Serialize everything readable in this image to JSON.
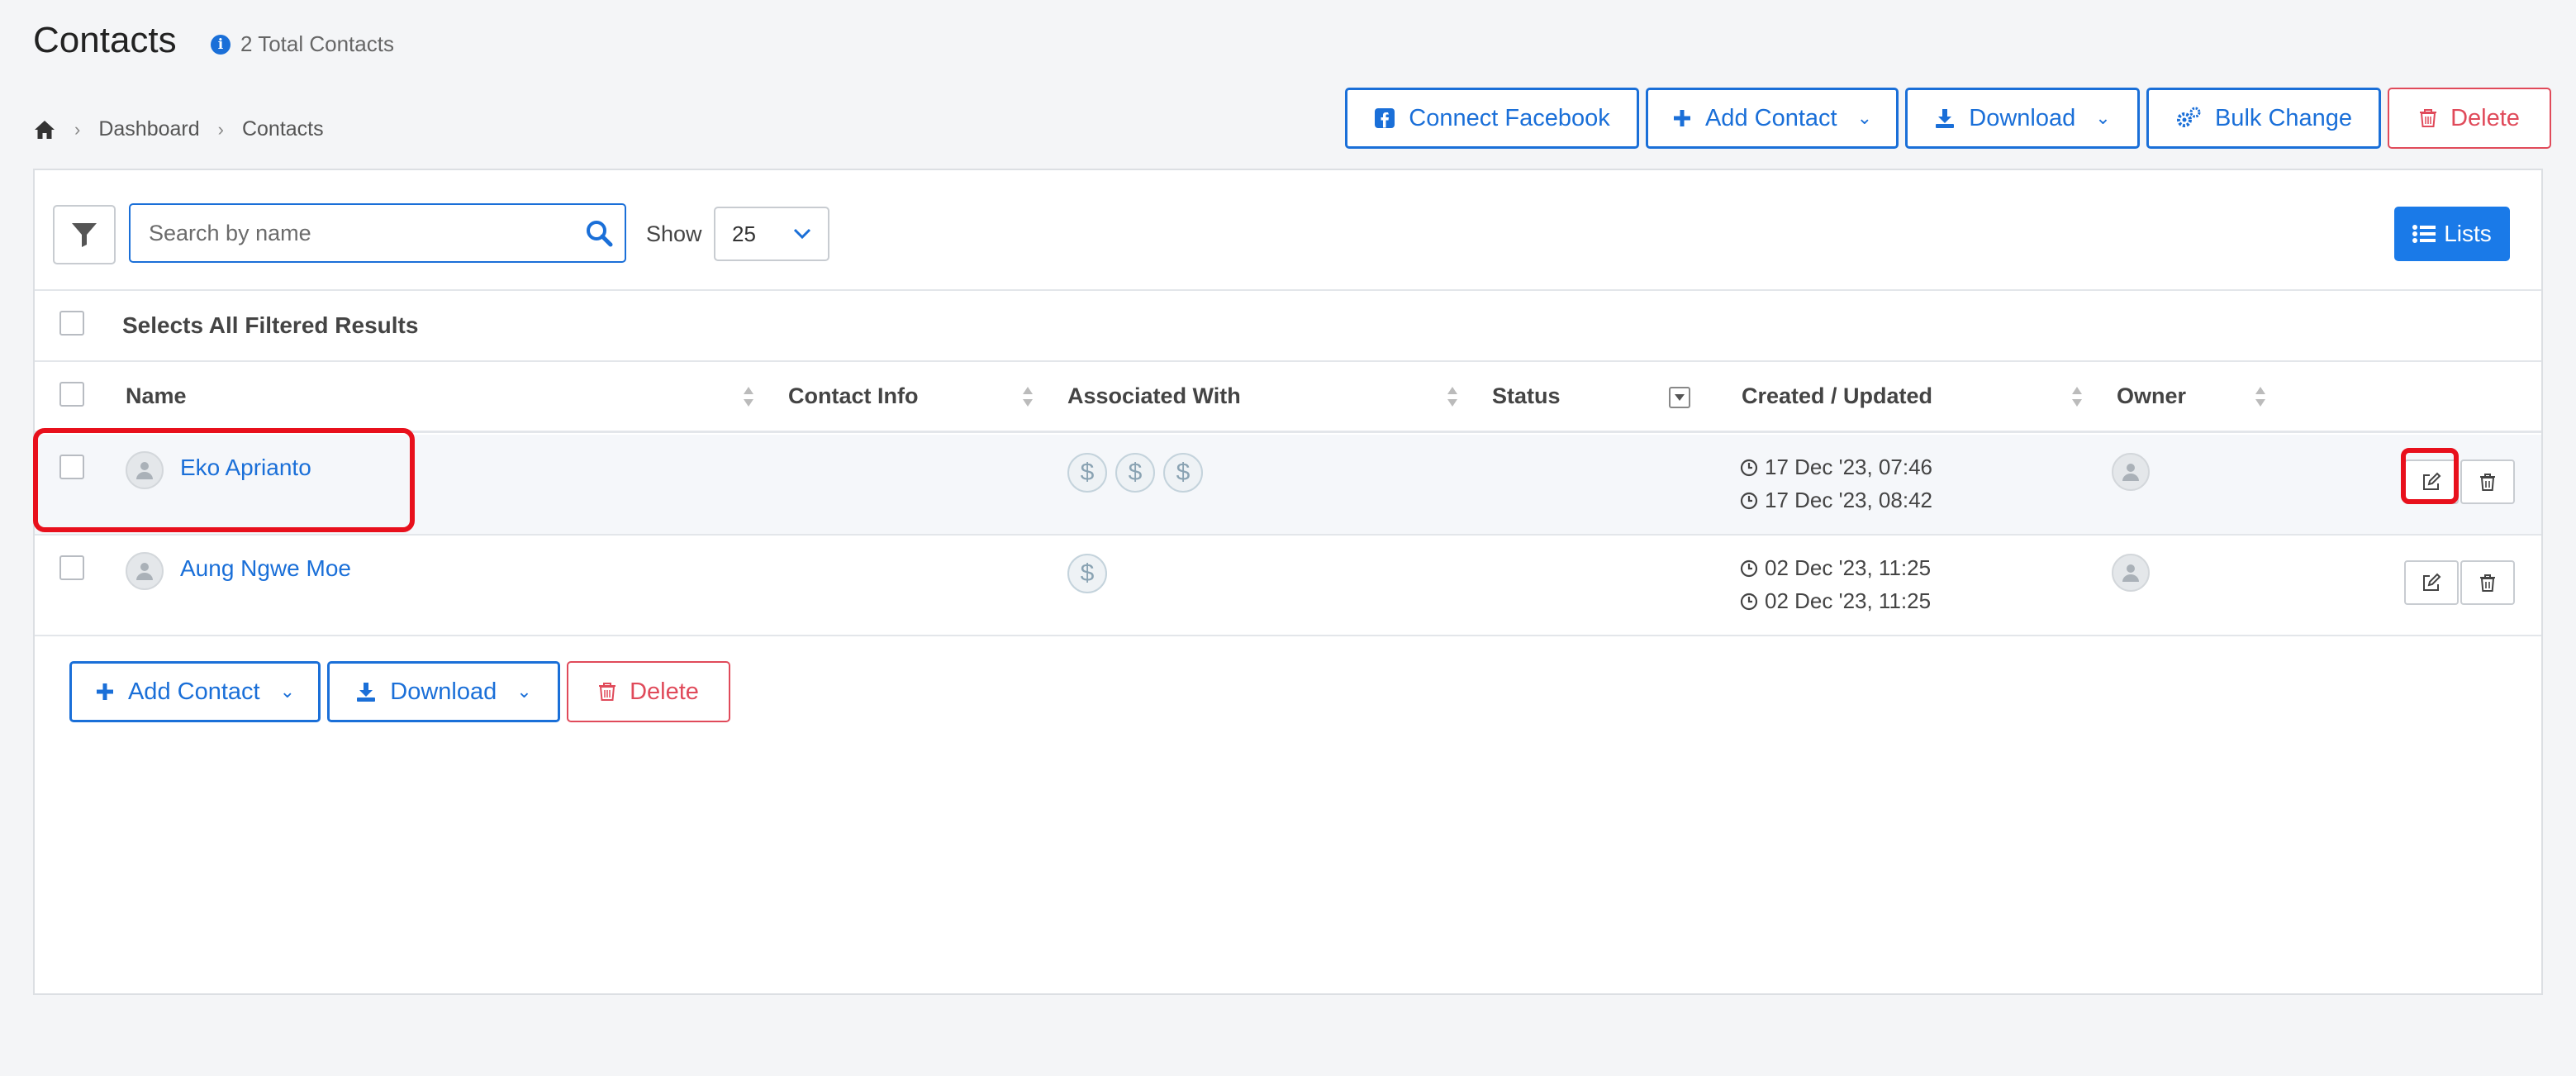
{
  "header": {
    "title": "Contacts",
    "total_contacts": "2 Total Contacts"
  },
  "breadcrumb": {
    "items": [
      "Dashboard",
      "Contacts"
    ]
  },
  "top_actions": {
    "connect_facebook": "Connect Facebook",
    "add_contact": "Add Contact",
    "download": "Download",
    "bulk_change": "Bulk Change",
    "delete": "Delete"
  },
  "toolbar": {
    "search_placeholder": "Search by name",
    "search_value": "",
    "show_label": "Show",
    "page_size": "25",
    "lists_label": "Lists"
  },
  "select_all_label": "Selects All Filtered Results",
  "table": {
    "columns": [
      "Name",
      "Contact Info",
      "Associated With",
      "Status",
      "Created / Updated",
      "Owner"
    ],
    "rows": [
      {
        "name": "Eko Aprianto",
        "associated_count": 3,
        "created": "17 Dec '23, 07:46",
        "updated": "17 Dec '23, 08:42"
      },
      {
        "name": "Aung Ngwe Moe",
        "associated_count": 1,
        "created": "02 Dec '23, 11:25",
        "updated": "02 Dec '23, 11:25"
      }
    ]
  },
  "bottom_actions": {
    "add_contact": "Add Contact",
    "download": "Download",
    "delete": "Delete"
  },
  "icons": {
    "associated": "dollar-icon",
    "action_edit": "edit-icon",
    "action_delete": "trash-icon"
  },
  "colors": {
    "primary": "#1a6fd8",
    "danger": "#e04a5a",
    "highlight": "#e8101c"
  }
}
